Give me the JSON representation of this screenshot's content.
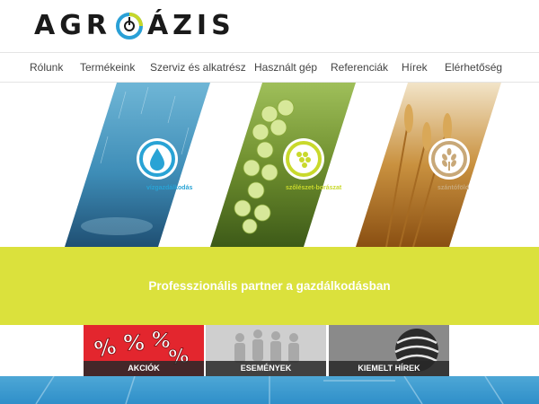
{
  "logo": {
    "text_left": "AGR",
    "text_right": "ÁZIS",
    "mark_color": "#2aa0d6",
    "mark_accent": "#c7d72a"
  },
  "nav": {
    "items": [
      {
        "label": "Rólunk"
      },
      {
        "label": "Termékeink"
      },
      {
        "label": "Szerviz és alkatrész"
      },
      {
        "label": "Használt gép"
      },
      {
        "label": "Referenciák"
      },
      {
        "label": "Hírek"
      },
      {
        "label": "Elérhetőség"
      }
    ]
  },
  "categories": [
    {
      "label": "vízgazdálkodás",
      "icon": "water-drop-icon",
      "color": "#29a3d5"
    },
    {
      "label": "szőlészet-borászat",
      "icon": "grape-icon",
      "color": "#c9d92c"
    },
    {
      "label": "szántóföld",
      "icon": "wheat-icon",
      "color": "#c8a878"
    }
  ],
  "banner": {
    "text": "Professzionális partner a gazdálkodásban",
    "color": "#dbe13c"
  },
  "tiles": [
    {
      "label": "AKCIÓK",
      "icon": "percent-icon"
    },
    {
      "label": "ESEMÉNYEK",
      "icon": "people-icon"
    },
    {
      "label": "KIEMELT HÍREK",
      "icon": "globe-icon"
    }
  ]
}
